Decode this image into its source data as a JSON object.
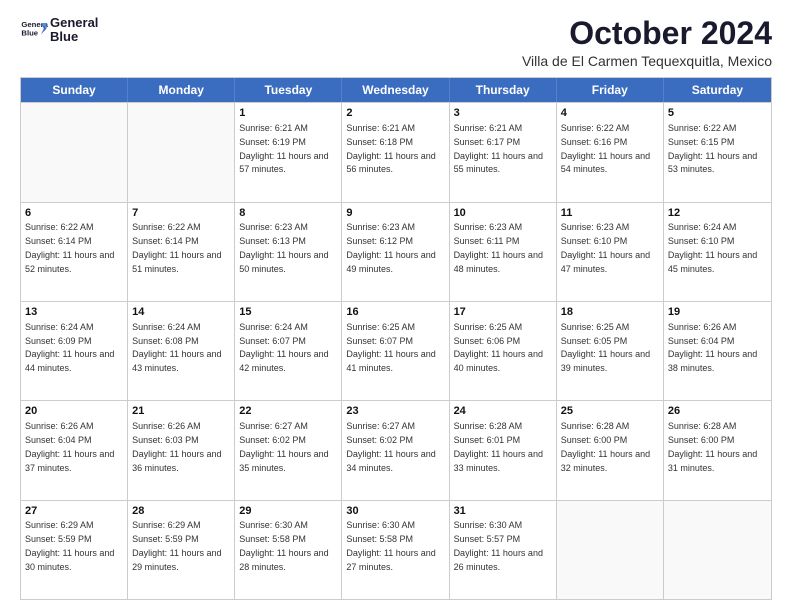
{
  "logo": {
    "line1": "General",
    "line2": "Blue"
  },
  "title": "October 2024",
  "subtitle": "Villa de El Carmen Tequexquitla, Mexico",
  "header": {
    "days": [
      "Sunday",
      "Monday",
      "Tuesday",
      "Wednesday",
      "Thursday",
      "Friday",
      "Saturday"
    ]
  },
  "weeks": [
    [
      {
        "day": "",
        "sunrise": "",
        "sunset": "",
        "daylight": ""
      },
      {
        "day": "",
        "sunrise": "",
        "sunset": "",
        "daylight": ""
      },
      {
        "day": "1",
        "sunrise": "Sunrise: 6:21 AM",
        "sunset": "Sunset: 6:19 PM",
        "daylight": "Daylight: 11 hours and 57 minutes."
      },
      {
        "day": "2",
        "sunrise": "Sunrise: 6:21 AM",
        "sunset": "Sunset: 6:18 PM",
        "daylight": "Daylight: 11 hours and 56 minutes."
      },
      {
        "day": "3",
        "sunrise": "Sunrise: 6:21 AM",
        "sunset": "Sunset: 6:17 PM",
        "daylight": "Daylight: 11 hours and 55 minutes."
      },
      {
        "day": "4",
        "sunrise": "Sunrise: 6:22 AM",
        "sunset": "Sunset: 6:16 PM",
        "daylight": "Daylight: 11 hours and 54 minutes."
      },
      {
        "day": "5",
        "sunrise": "Sunrise: 6:22 AM",
        "sunset": "Sunset: 6:15 PM",
        "daylight": "Daylight: 11 hours and 53 minutes."
      }
    ],
    [
      {
        "day": "6",
        "sunrise": "Sunrise: 6:22 AM",
        "sunset": "Sunset: 6:14 PM",
        "daylight": "Daylight: 11 hours and 52 minutes."
      },
      {
        "day": "7",
        "sunrise": "Sunrise: 6:22 AM",
        "sunset": "Sunset: 6:14 PM",
        "daylight": "Daylight: 11 hours and 51 minutes."
      },
      {
        "day": "8",
        "sunrise": "Sunrise: 6:23 AM",
        "sunset": "Sunset: 6:13 PM",
        "daylight": "Daylight: 11 hours and 50 minutes."
      },
      {
        "day": "9",
        "sunrise": "Sunrise: 6:23 AM",
        "sunset": "Sunset: 6:12 PM",
        "daylight": "Daylight: 11 hours and 49 minutes."
      },
      {
        "day": "10",
        "sunrise": "Sunrise: 6:23 AM",
        "sunset": "Sunset: 6:11 PM",
        "daylight": "Daylight: 11 hours and 48 minutes."
      },
      {
        "day": "11",
        "sunrise": "Sunrise: 6:23 AM",
        "sunset": "Sunset: 6:10 PM",
        "daylight": "Daylight: 11 hours and 47 minutes."
      },
      {
        "day": "12",
        "sunrise": "Sunrise: 6:24 AM",
        "sunset": "Sunset: 6:10 PM",
        "daylight": "Daylight: 11 hours and 45 minutes."
      }
    ],
    [
      {
        "day": "13",
        "sunrise": "Sunrise: 6:24 AM",
        "sunset": "Sunset: 6:09 PM",
        "daylight": "Daylight: 11 hours and 44 minutes."
      },
      {
        "day": "14",
        "sunrise": "Sunrise: 6:24 AM",
        "sunset": "Sunset: 6:08 PM",
        "daylight": "Daylight: 11 hours and 43 minutes."
      },
      {
        "day": "15",
        "sunrise": "Sunrise: 6:24 AM",
        "sunset": "Sunset: 6:07 PM",
        "daylight": "Daylight: 11 hours and 42 minutes."
      },
      {
        "day": "16",
        "sunrise": "Sunrise: 6:25 AM",
        "sunset": "Sunset: 6:07 PM",
        "daylight": "Daylight: 11 hours and 41 minutes."
      },
      {
        "day": "17",
        "sunrise": "Sunrise: 6:25 AM",
        "sunset": "Sunset: 6:06 PM",
        "daylight": "Daylight: 11 hours and 40 minutes."
      },
      {
        "day": "18",
        "sunrise": "Sunrise: 6:25 AM",
        "sunset": "Sunset: 6:05 PM",
        "daylight": "Daylight: 11 hours and 39 minutes."
      },
      {
        "day": "19",
        "sunrise": "Sunrise: 6:26 AM",
        "sunset": "Sunset: 6:04 PM",
        "daylight": "Daylight: 11 hours and 38 minutes."
      }
    ],
    [
      {
        "day": "20",
        "sunrise": "Sunrise: 6:26 AM",
        "sunset": "Sunset: 6:04 PM",
        "daylight": "Daylight: 11 hours and 37 minutes."
      },
      {
        "day": "21",
        "sunrise": "Sunrise: 6:26 AM",
        "sunset": "Sunset: 6:03 PM",
        "daylight": "Daylight: 11 hours and 36 minutes."
      },
      {
        "day": "22",
        "sunrise": "Sunrise: 6:27 AM",
        "sunset": "Sunset: 6:02 PM",
        "daylight": "Daylight: 11 hours and 35 minutes."
      },
      {
        "day": "23",
        "sunrise": "Sunrise: 6:27 AM",
        "sunset": "Sunset: 6:02 PM",
        "daylight": "Daylight: 11 hours and 34 minutes."
      },
      {
        "day": "24",
        "sunrise": "Sunrise: 6:28 AM",
        "sunset": "Sunset: 6:01 PM",
        "daylight": "Daylight: 11 hours and 33 minutes."
      },
      {
        "day": "25",
        "sunrise": "Sunrise: 6:28 AM",
        "sunset": "Sunset: 6:00 PM",
        "daylight": "Daylight: 11 hours and 32 minutes."
      },
      {
        "day": "26",
        "sunrise": "Sunrise: 6:28 AM",
        "sunset": "Sunset: 6:00 PM",
        "daylight": "Daylight: 11 hours and 31 minutes."
      }
    ],
    [
      {
        "day": "27",
        "sunrise": "Sunrise: 6:29 AM",
        "sunset": "Sunset: 5:59 PM",
        "daylight": "Daylight: 11 hours and 30 minutes."
      },
      {
        "day": "28",
        "sunrise": "Sunrise: 6:29 AM",
        "sunset": "Sunset: 5:59 PM",
        "daylight": "Daylight: 11 hours and 29 minutes."
      },
      {
        "day": "29",
        "sunrise": "Sunrise: 6:30 AM",
        "sunset": "Sunset: 5:58 PM",
        "daylight": "Daylight: 11 hours and 28 minutes."
      },
      {
        "day": "30",
        "sunrise": "Sunrise: 6:30 AM",
        "sunset": "Sunset: 5:58 PM",
        "daylight": "Daylight: 11 hours and 27 minutes."
      },
      {
        "day": "31",
        "sunrise": "Sunrise: 6:30 AM",
        "sunset": "Sunset: 5:57 PM",
        "daylight": "Daylight: 11 hours and 26 minutes."
      },
      {
        "day": "",
        "sunrise": "",
        "sunset": "",
        "daylight": ""
      },
      {
        "day": "",
        "sunrise": "",
        "sunset": "",
        "daylight": ""
      }
    ]
  ]
}
